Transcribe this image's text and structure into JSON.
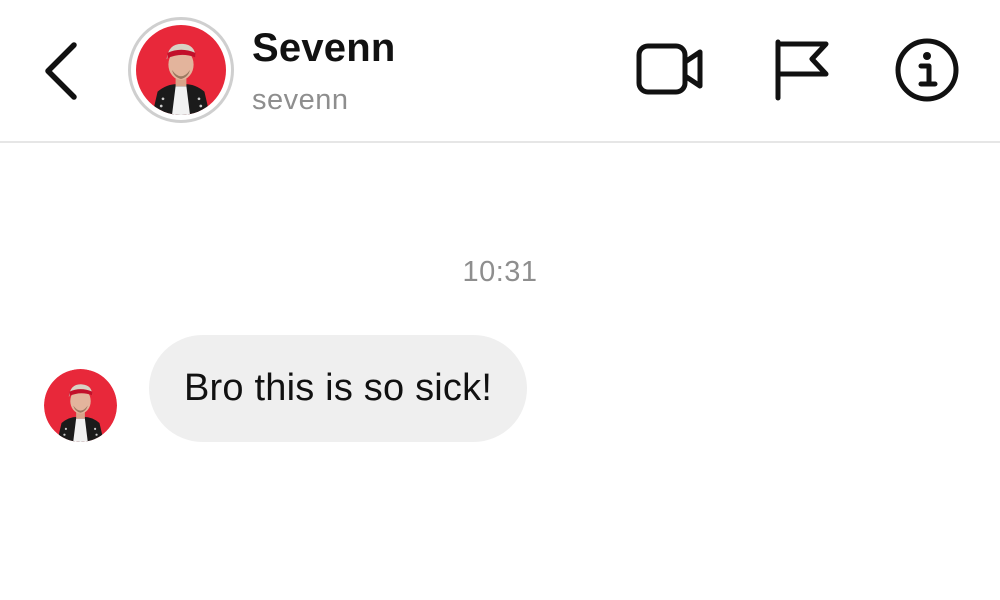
{
  "header": {
    "display_name": "Sevenn",
    "username": "sevenn",
    "icons": {
      "back": "chevron-left-icon",
      "video": "video-call-icon",
      "report": "flag-icon",
      "info": "info-icon"
    }
  },
  "conversation": {
    "timestamp": "10:31",
    "messages": [
      {
        "sender": "sevenn",
        "text": "Bro this is so sick!"
      }
    ]
  },
  "colors": {
    "avatar_background": "#e8283a",
    "bubble_background": "#efefef",
    "secondary_text": "#8e8e8e",
    "primary_text": "#111111"
  }
}
